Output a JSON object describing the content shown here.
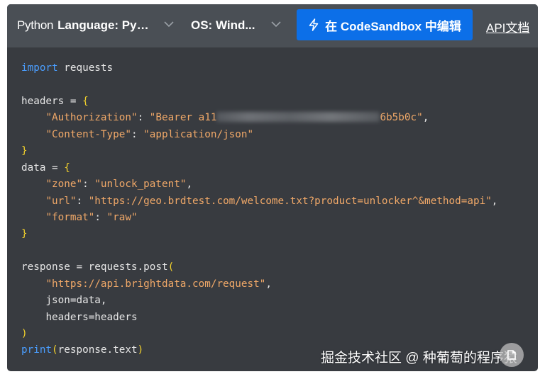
{
  "toolbar": {
    "language_label": "Python",
    "language_value": "Language: Pyt...",
    "os_value": "OS: Wind...",
    "sandbox_button": "在 CodeSandbox 中编辑",
    "api_docs_link": "API文档"
  },
  "code": {
    "l1_kw": "import",
    "l1_rest": " requests",
    "l3_a": "headers = ",
    "l3_b": "{",
    "l4_key": "\"Authorization\"",
    "l4_colon": ": ",
    "l4_val_start": "\"Bearer a11",
    "l4_val_end": "6b5b0c\"",
    "l4_comma": ",",
    "l5_key": "\"Content-Type\"",
    "l5_colon": ": ",
    "l5_val": "\"application/json\"",
    "l6": "}",
    "l7_a": "data = ",
    "l7_b": "{",
    "l8_key": "\"zone\"",
    "l8_colon": ": ",
    "l8_val": "\"unlock_patent\"",
    "l8_comma": ",",
    "l9_key": "\"url\"",
    "l9_colon": ": ",
    "l9_val": "\"https://geo.brdtest.com/welcome.txt?product=unlocker^&method=api\"",
    "l9_comma": ",",
    "l10_key": "\"format\"",
    "l10_colon": ": ",
    "l10_val": "\"raw\"",
    "l11": "}",
    "l13_a": "response = requests.post",
    "l13_b": "(",
    "l14_val": "\"https://api.brightdata.com/request\"",
    "l14_comma": ",",
    "l15": "json=data,",
    "l16": "headers=headers",
    "l17": ")",
    "l18_kw": "print",
    "l18_open": "(",
    "l18_mid": "response.text",
    "l18_close": ")"
  },
  "watermark": {
    "text": "掘金技术社区 @ 种葡萄的程序猿"
  },
  "colors": {
    "panel_bg": "#383b40",
    "toolbar_bg": "#4a4f55",
    "cta_bg": "#0c6fe8",
    "keyword": "#4a9eff",
    "string": "#f0a868",
    "bracket": "#f2d12c"
  },
  "icons": {
    "bolt": "lightning-bolt-icon",
    "chevron": "chevron-down-icon",
    "watermark_logo": "juejin-logo-icon"
  }
}
